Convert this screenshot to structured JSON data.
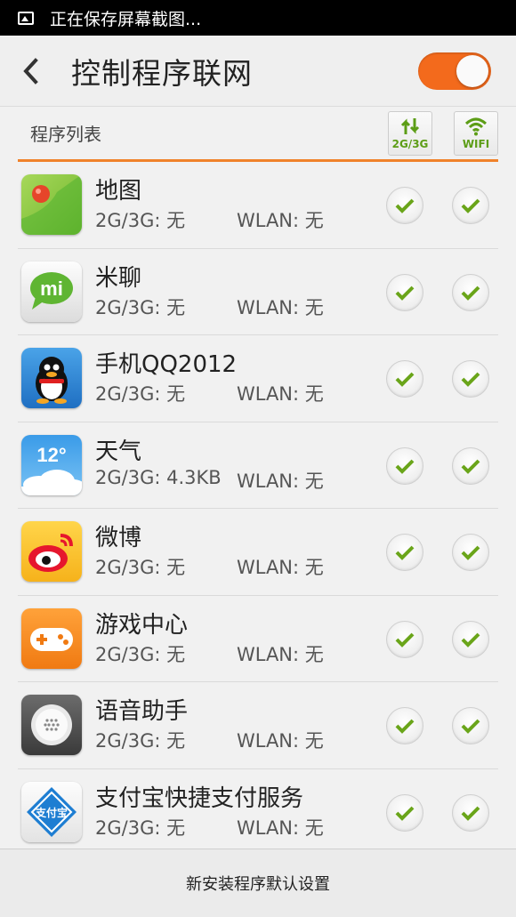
{
  "status_bar": {
    "text": "正在保存屏幕截图...",
    "icon": "image-icon"
  },
  "title_bar": {
    "back_icon": "back-arrow-icon",
    "title": "控制程序联网",
    "toggle_on": true,
    "toggle_color": "#f36a1c"
  },
  "list_header": {
    "label": "程序列表",
    "mobile_button": {
      "label": "2G/3G",
      "icon": "sync-arrows-icon"
    },
    "wifi_button": {
      "label": "WIFI",
      "icon": "wifi-icon"
    },
    "accent_color": "#f0822a"
  },
  "apps": [
    {
      "name": "地图",
      "mobile_usage": "2G/3G: 无",
      "wlan_usage": "WLAN: 无",
      "icon": "map-icon",
      "mobile_allowed": true,
      "wifi_allowed": true
    },
    {
      "name": "米聊",
      "mobile_usage": "2G/3G: 无",
      "wlan_usage": "WLAN: 无",
      "icon": "michat-icon",
      "icon_text": "mi",
      "mobile_allowed": true,
      "wifi_allowed": true
    },
    {
      "name": "手机QQ2012",
      "mobile_usage": "2G/3G: 无",
      "wlan_usage": "WLAN: 无",
      "icon": "qq-penguin-icon",
      "mobile_allowed": true,
      "wifi_allowed": true
    },
    {
      "name": "天气",
      "mobile_usage": "2G/3G: 4.3KB",
      "wlan_usage": "WLAN: 无",
      "icon": "weather-icon",
      "icon_text": "12°",
      "mobile_allowed": true,
      "wifi_allowed": true
    },
    {
      "name": "微博",
      "mobile_usage": "2G/3G: 无",
      "wlan_usage": "WLAN: 无",
      "icon": "weibo-icon",
      "mobile_allowed": true,
      "wifi_allowed": true
    },
    {
      "name": "游戏中心",
      "mobile_usage": "2G/3G: 无",
      "wlan_usage": "WLAN: 无",
      "icon": "gamepad-icon",
      "mobile_allowed": true,
      "wifi_allowed": true
    },
    {
      "name": "语音助手",
      "mobile_usage": "2G/3G: 无",
      "wlan_usage": "WLAN: 无",
      "icon": "voice-assistant-icon",
      "mobile_allowed": true,
      "wifi_allowed": true
    },
    {
      "name": "支付宝快捷支付服务",
      "mobile_usage": "2G/3G: 无",
      "wlan_usage": "WLAN: 无",
      "icon": "alipay-icon",
      "icon_text": "支付宝",
      "mobile_allowed": true,
      "wifi_allowed": true
    }
  ],
  "footer": {
    "label": "新安装程序默认设置"
  },
  "colors": {
    "check_green": "#6aa51a"
  }
}
